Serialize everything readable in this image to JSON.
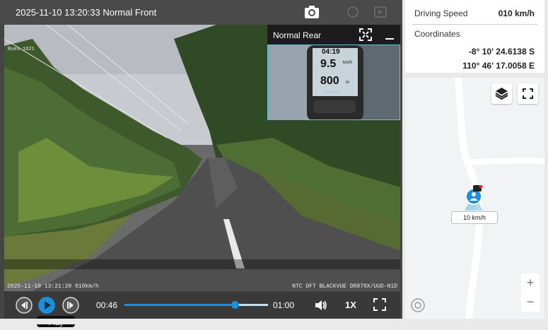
{
  "player": {
    "title": "2025-11-10 13:20:33 Normal Front",
    "camera_label": "Rues 1621",
    "overlay_left": "2025-11-10 13:21:20 010km/h",
    "overlay_right": "NTC DFT BLACKVUE DR970X/UUD-N1D",
    "pip": {
      "title": "Normal Rear",
      "gps_time": "04:19",
      "gps_speed": "9.5",
      "gps_unit": "km/h",
      "gps_dist": "800",
      "gps_dist_unit": "m",
      "gps_brand": "GARMIN"
    },
    "controls": {
      "current_time": "00:46",
      "end_time": "01:00",
      "progress": 0.77,
      "speed": "1X",
      "tooltip": "Play"
    }
  },
  "info": {
    "driving_speed_label": "Driving Speed",
    "driving_speed_value": "010 km/h",
    "coordinates_label": "Coordinates",
    "lat": "-8° 10' 24.6138 S",
    "lon": "110° 46' 17.0058 E"
  },
  "map": {
    "speed_label": "10 km/h",
    "zoom_in": "+",
    "zoom_out": "−"
  },
  "colors": {
    "accent": "#1b8fd8",
    "pip_border": "#5fc0d8"
  }
}
